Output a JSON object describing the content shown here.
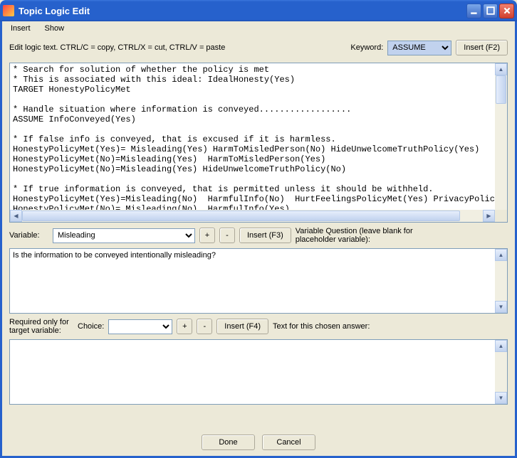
{
  "window": {
    "title": "Topic Logic Edit"
  },
  "menu": {
    "insert": "Insert",
    "show": "Show"
  },
  "hint": "Edit logic text.  CTRL/C = copy, CTRL/X  = cut, CTRL/V = paste",
  "keyword_label": "Keyword:",
  "keyword_value": "ASSUME",
  "insert_f2": "Insert (F2)",
  "logic_text": "* Search for solution of whether the policy is met\n* This is associated with this ideal: IdealHonesty(Yes)\nTARGET HonestyPolicyMet\n\n* Handle situation where information is conveyed..................\nASSUME InfoConveyed(Yes)\n\n* If false info is conveyed, that is excused if it is harmless.\nHonestyPolicyMet(Yes)= Misleading(Yes) HarmToMisledPerson(No) HideUnwelcomeTruthPolicy(Yes)\nHonestyPolicyMet(No)=Misleading(Yes)  HarmToMisledPerson(Yes)\nHonestyPolicyMet(No)=Misleading(Yes) HideUnwelcomeTruthPolicy(No)\n\n* If true information is conveyed, that is permitted unless it should be withheld.\nHonestyPolicyMet(Yes)=Misleading(No)  HarmfulInfo(No)  HurtFeelingsPolicyMet(Yes) PrivacyPolicyMet\nHonestyPolicyMet(No)= Misleading(No)  HarmfulInfo(Yes)\nHonestyPolicyMet(No)= Misleading(No)  HurtFeelingsPolicyMet(No)",
  "variable_label": "Variable:",
  "variable_value": "Misleading",
  "plus": "+",
  "minus": "-",
  "insert_f3": "Insert (F3)",
  "varq_label": "Variable Question (leave blank for placeholder variable):",
  "varq_text": "Is the information to be conveyed intentionally misleading?",
  "req_label": "Required only for\ntarget variable:",
  "choice_label": "Choice:",
  "choice_value": "",
  "insert_f4": "Insert (F4)",
  "choice_text_label": "Text for this chosen answer:",
  "choice_text": "",
  "done": "Done",
  "cancel": "Cancel"
}
